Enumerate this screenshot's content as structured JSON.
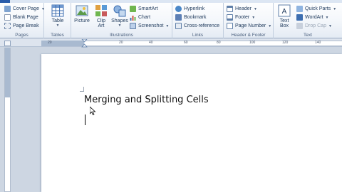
{
  "ribbon": {
    "pages": {
      "label": "Pages",
      "cover_page": "Cover Page",
      "blank_page": "Blank Page",
      "page_break": "Page Break"
    },
    "tables": {
      "label": "Tables",
      "table": "Table"
    },
    "illustrations": {
      "label": "Illustrations",
      "picture": "Picture",
      "clip_art_line1": "Clip",
      "clip_art_line2": "Art",
      "shapes": "Shapes",
      "smartart": "SmartArt",
      "chart": "Chart",
      "screenshot": "Screenshot"
    },
    "links": {
      "label": "Links",
      "hyperlink": "Hyperlink",
      "bookmark": "Bookmark",
      "cross_reference": "Cross-reference"
    },
    "header_footer": {
      "label": "Header & Footer",
      "header": "Header",
      "footer": "Footer",
      "page_number": "Page Number"
    },
    "text": {
      "label": "Text",
      "text_box_line1": "Text",
      "text_box_line2": "Box",
      "quick_parts": "Quick Parts",
      "wordart": "WordArt",
      "drop_cap": "Drop Cap"
    }
  },
  "ruler": {
    "marks": [
      "20",
      "40",
      "60",
      "80",
      "100",
      "120",
      "140"
    ]
  },
  "document": {
    "heading": "Merging and Splitting Cells"
  },
  "colors": {
    "ribbon_text": "#1e395b",
    "ruler_margin": "#a9bad0",
    "file_tab": "#2a5caa"
  }
}
